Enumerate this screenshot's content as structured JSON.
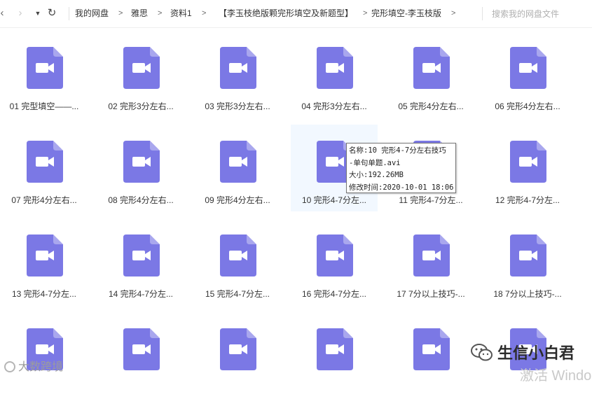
{
  "toolbar": {
    "back_icon": "chevron-left-icon",
    "forward_icon": "chevron-right-icon",
    "dropdown_icon": "caret-down-icon",
    "refresh_icon": "refresh-icon",
    "search_placeholder": "搜索我的网盘文件"
  },
  "breadcrumbs": [
    {
      "label": "我的网盘"
    },
    {
      "label": "雅思"
    },
    {
      "label": "资料1"
    },
    {
      "label": "【李玉枝绝版颗完形填空及新题型】"
    },
    {
      "label": "完形填空-李玉枝版"
    }
  ],
  "files": [
    {
      "name": "01 完型填空——..."
    },
    {
      "name": "02 完形3分左右..."
    },
    {
      "name": "03 完形3分左右..."
    },
    {
      "name": "04 完形3分左右..."
    },
    {
      "name": "05 完形4分左右..."
    },
    {
      "name": "06 完形4分左右..."
    },
    {
      "name": "07 完形4分左右..."
    },
    {
      "name": "08 完形4分左右..."
    },
    {
      "name": "09 完形4分左右..."
    },
    {
      "name": "10 完形4-7分左..."
    },
    {
      "name": "11 完形4-7分左..."
    },
    {
      "name": "12 完形4-7分左..."
    },
    {
      "name": "13 完形4-7分左..."
    },
    {
      "name": "14 完形4-7分左..."
    },
    {
      "name": "15 完形4-7分左..."
    },
    {
      "name": "16 完形4-7分左..."
    },
    {
      "name": "17 7分以上技巧-..."
    },
    {
      "name": "18 7分以上技巧-..."
    },
    {
      "name": ""
    },
    {
      "name": ""
    },
    {
      "name": ""
    },
    {
      "name": ""
    },
    {
      "name": ""
    },
    {
      "name": ""
    }
  ],
  "file_icon_color": "#7b78e5",
  "hover_index": 9,
  "tooltip": {
    "line1": "名称:10 完形4-7分左右技巧",
    "line2": "-单句单题.avi",
    "line3": "大小:192.26MB",
    "line4": "修改时间:2020-10-01 18:06"
  },
  "watermarks": {
    "left": "大数跨境",
    "right": "生信小白君",
    "windows": "激活 Windo"
  }
}
